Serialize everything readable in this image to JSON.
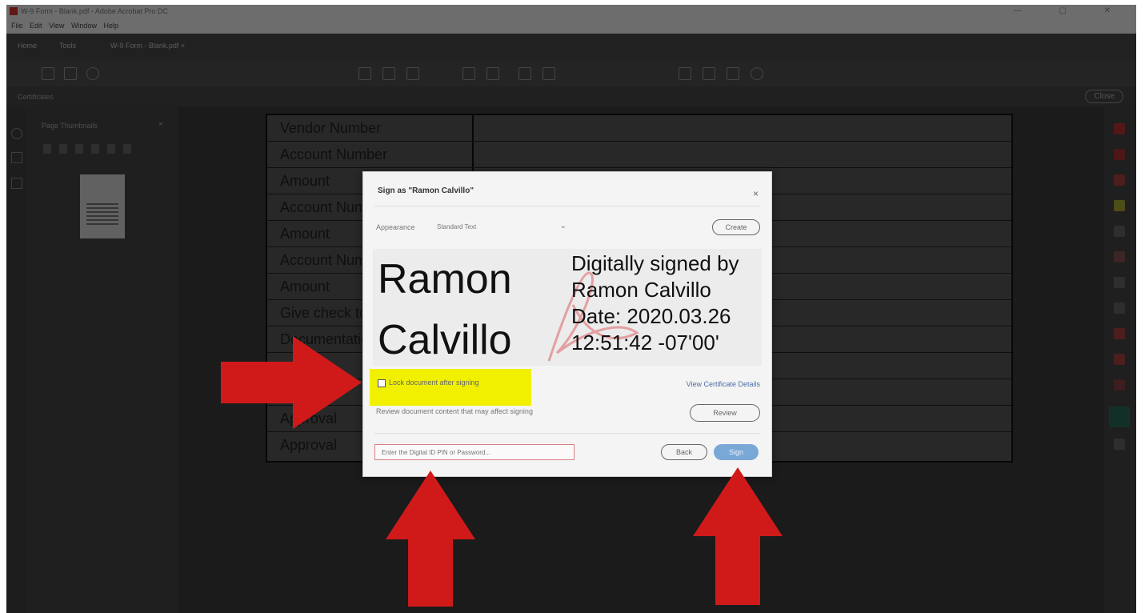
{
  "window": {
    "title": "W-9 Form - Blank.pdf - Adobe Acrobat Pro DC",
    "controls": "— ▢ ✕"
  },
  "menubar": [
    "File",
    "Edit",
    "View",
    "Window",
    "Help"
  ],
  "tabs": [
    "Home",
    "Tools",
    "W-9 Form - Blank.pdf ×"
  ],
  "sidebar": {
    "header": "Certificates",
    "panel_title": "Page Thumbnails"
  },
  "toolbar_right": {
    "close_label": "Close"
  },
  "document": {
    "rows": [
      "Vendor Number",
      "Account Number",
      "Amount",
      "Account Number",
      "Amount",
      "Account Number",
      "Amount",
      "Give check to",
      "Documentation",
      "",
      "",
      "Approval",
      "Approval"
    ]
  },
  "dialog": {
    "title": "Sign as \"Ramon Calvillo\"",
    "close": "×",
    "appearance_label": "Appearance",
    "appearance_value": "Standard Text",
    "create_label": "Create",
    "signature_name": [
      "Ramon",
      "Calvillo"
    ],
    "signature_details": [
      "Digitally signed by",
      "Ramon Calvillo",
      "Date: 2020.03.26",
      "12:51:42 -07'00'"
    ],
    "lock_label": "Lock document after signing",
    "lock_checked": false,
    "cert_link": "View Certificate Details",
    "review_text": "Review document content that may affect signing",
    "review_label": "Review",
    "password_placeholder": "Enter the Digital ID PIN or Password...",
    "back_label": "Back",
    "sign_label": "Sign"
  },
  "colors": {
    "highlight": "#f0f000",
    "arrow": "#d01a1a",
    "sign_button": "#7aa8d6",
    "link": "#4b6ea8"
  }
}
